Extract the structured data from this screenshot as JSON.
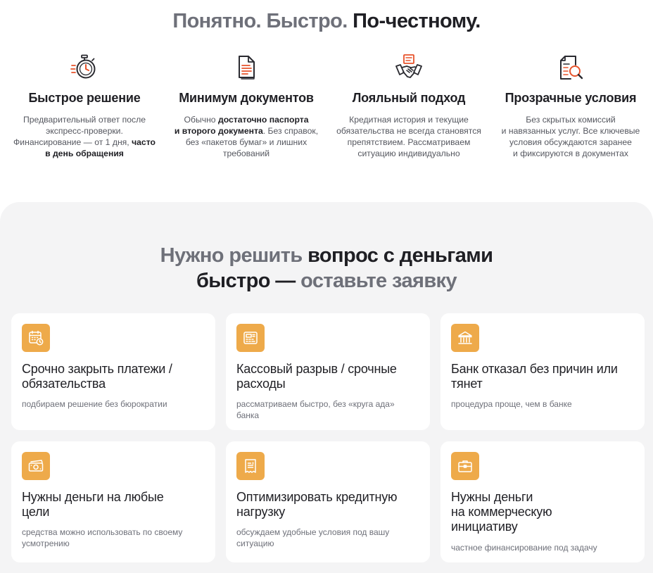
{
  "hero": {
    "title_light": "Понятно. Быстро.",
    "title_dark": "По-честному."
  },
  "features": [
    {
      "icon": "stopwatch-icon",
      "title": "Быстрое решение",
      "line1": "Предварительный ответ после",
      "line2": "экспресс-проверки.",
      "line3": "Финансирование — от 1 дня,",
      "line3_bold": "часто",
      "line4_bold": "в день обращения"
    },
    {
      "icon": "document-icon",
      "title": "Минимум документов",
      "line1_pre": "Обычно",
      "line1_bold": "достаточно паспорта",
      "line2_bold": "и второго документа",
      "line2_post": ". Без справок,",
      "line3": "без «пакетов бумаг» и лишних",
      "line4": "требований"
    },
    {
      "icon": "handshake-icon",
      "title": "Лояльный подход",
      "line1": "Кредитная история и текущие",
      "line2": "обязательства не всегда становятся",
      "line3": "препятствием. Рассматриваем",
      "line4": "ситуацию индивидуально"
    },
    {
      "icon": "document-search-icon",
      "title": "Прозрачные условия",
      "line1": "Без скрытых комиссий",
      "line2": "и навязанных услуг. Все ключевые",
      "line3": "условия обсуждаются заранее",
      "line4": "и фиксируются в документах"
    }
  ],
  "panel": {
    "title_light_1": "Нужно решить",
    "title_dark_1": "вопрос с деньгами",
    "title_dark_2": "быстро —",
    "title_light_2": "оставьте заявку"
  },
  "cards": [
    {
      "icon": "calendar-clock-icon",
      "title_l1": "Срочно закрыть платежи /",
      "title_l2": "обязательства",
      "desc_l1": "подбираем решение без бюрократии",
      "desc_l2": ""
    },
    {
      "icon": "cash-register-icon",
      "title_l1": "Кассовый разрыв / срочные",
      "title_l2": "расходы",
      "desc_l1": "рассматриваем быстро, без «круга ада»",
      "desc_l2": "банка"
    },
    {
      "icon": "bank-icon",
      "title_l1": "Банк отказал без причин или",
      "title_l2": "тянет",
      "desc_l1": "процедура проще, чем в банке",
      "desc_l2": ""
    },
    {
      "icon": "banknote-icon",
      "title_l1": "Нужны деньги на любые",
      "title_l2": "цели",
      "desc_l1": "средства можно использовать по своему",
      "desc_l2": "усмотрению"
    },
    {
      "icon": "receipt-icon",
      "title_l1": "Оптимизировать кредитную",
      "title_l2": "нагрузку",
      "desc_l1": "обсуждаем удобные условия под вашу",
      "desc_l2": "ситуацию"
    },
    {
      "icon": "briefcase-icon",
      "title_l1": "Нужны деньги",
      "title_l2": "на коммерческую",
      "title_l3": "инициативу",
      "desc_l1": "частное финансирование под задачу",
      "desc_l2": ""
    }
  ],
  "colors": {
    "accent_orange": "#e8532b",
    "icon_tile": "#eeaa4a",
    "text_dark": "#1f1f24",
    "text_muted": "#6e7079",
    "panel_bg": "#f4f4f5"
  }
}
